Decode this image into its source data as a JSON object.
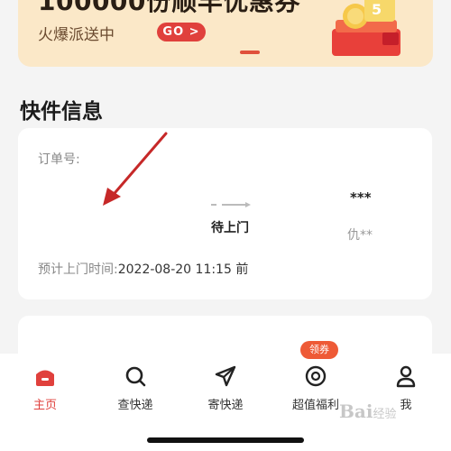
{
  "banner": {
    "title": "100000份顺丰优惠券",
    "subtitle": "火爆派送中",
    "go_label": "GO >"
  },
  "section": {
    "title": "快件信息"
  },
  "order": {
    "order_no_label": "订单号:",
    "status": "待上门",
    "recipient_masked": "***",
    "city_masked": "仇**",
    "eta_label": "预计上门时间:",
    "eta_value": "2022-08-20 11:15 前"
  },
  "tabs": [
    {
      "label": "主页",
      "icon": "home-icon",
      "active": true
    },
    {
      "label": "查快递",
      "icon": "search-icon",
      "active": false
    },
    {
      "label": "寄快递",
      "icon": "send-icon",
      "active": false
    },
    {
      "label": "超值福利",
      "icon": "coin-icon",
      "active": false
    },
    {
      "label": "我",
      "icon": "profile-icon",
      "active": false
    }
  ],
  "badge": {
    "label": "领券"
  },
  "watermark": {
    "text": "Bai",
    "sub": "经验"
  },
  "colors": {
    "accent": "#e0403c",
    "banner_bg": "#fbe8c8",
    "annotation": "#c62828"
  }
}
